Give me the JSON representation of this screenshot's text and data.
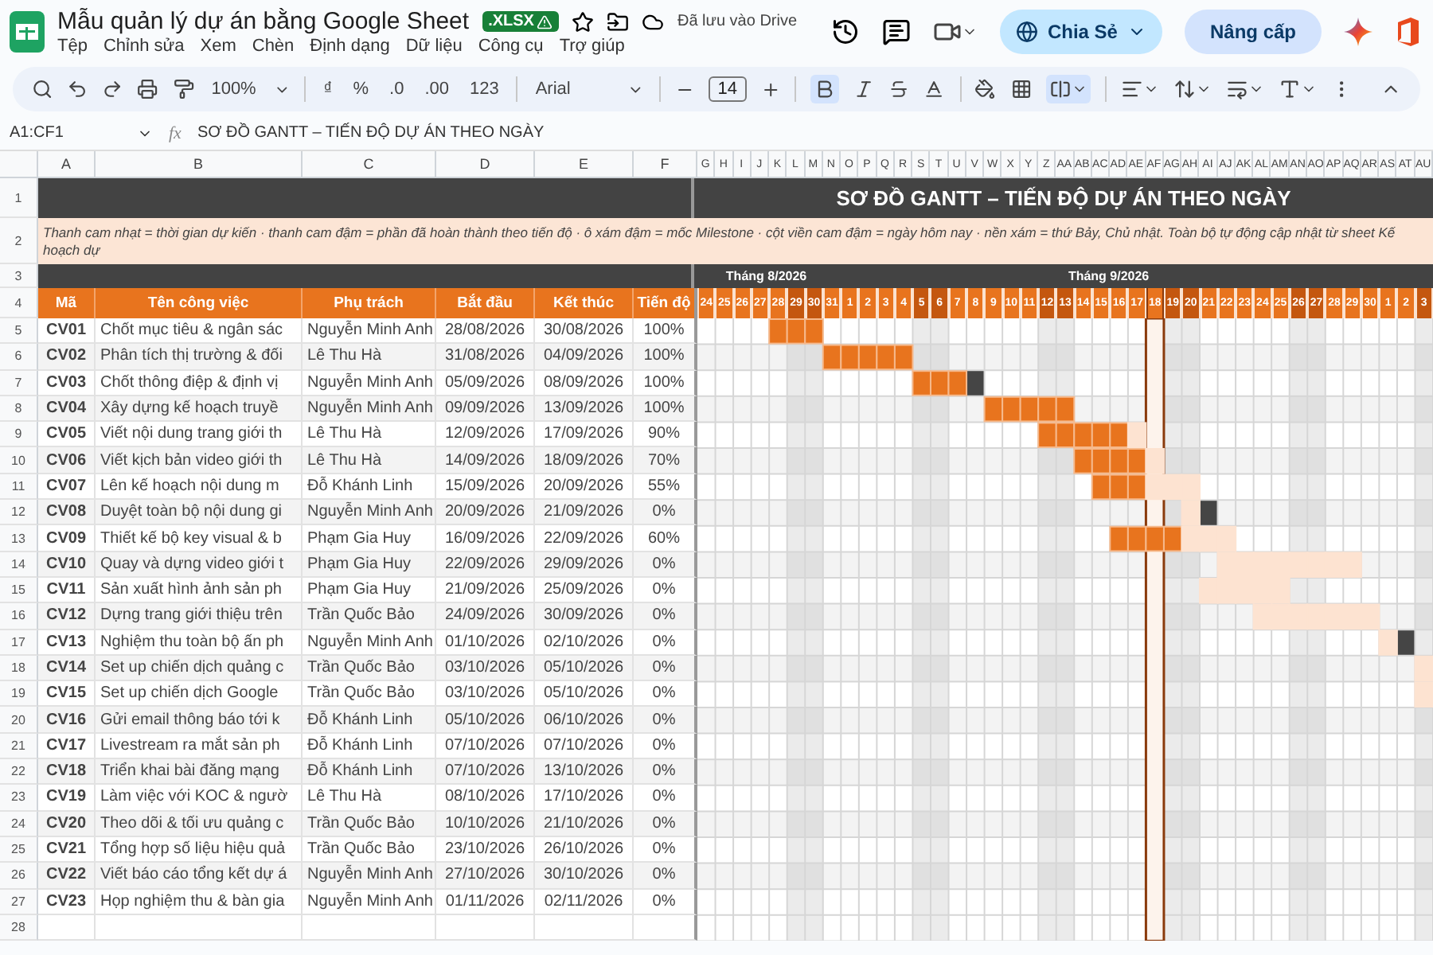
{
  "doc": {
    "title": "Mẫu quản lý dự án bằng Google Sheet",
    "badge": ".XLSX",
    "saved": "Đã lưu vào Drive"
  },
  "menu": [
    "Tệp",
    "Chỉnh sửa",
    "Xem",
    "Chèn",
    "Định dạng",
    "Dữ liệu",
    "Công cụ",
    "Trợ giúp"
  ],
  "actions": {
    "share": "Chia Sẻ",
    "upgrade": "Nâng cấp"
  },
  "toolbar": {
    "zoom": "100%",
    "currency": "₫",
    "percent": "%",
    "dec_less": ".0",
    "dec_more": ".00",
    "number_format": "123",
    "font": "Arial",
    "font_size": "14",
    "bold_selected": true,
    "merge_selected": true
  },
  "formula_bar": {
    "range": "A1:CF1",
    "fx": "fx",
    "value": "SƠ ĐỒ GANTT – TIẾN ĐỘ DỰ ÁN THEO NGÀY"
  },
  "columns": [
    "A",
    "B",
    "C",
    "D",
    "E",
    "F"
  ],
  "gantt_columns": [
    "G",
    "H",
    "I",
    "J",
    "K",
    "L",
    "M",
    "N",
    "O",
    "P",
    "Q",
    "R",
    "S",
    "T",
    "U",
    "V",
    "W",
    "X",
    "Y",
    "Z",
    "AA",
    "AB",
    "AC",
    "AD",
    "AE",
    "AF",
    "AG",
    "AH",
    "AI",
    "AJ",
    "AK",
    "AL",
    "AM",
    "AN",
    "AO",
    "AP",
    "AQ",
    "AR",
    "AS",
    "AT",
    "AU"
  ],
  "header_rows": [
    "1",
    "2",
    "3",
    "4"
  ],
  "title": "SƠ ĐỒ GANTT – TIẾN ĐỘ DỰ ÁN THEO NGÀY",
  "note": "Thanh cam nhạt = thời gian dự kiến · thanh cam đậm = phần đã hoàn thành theo tiến độ · ô xám đậm = mốc Milestone · cột viền cam đậm = ngày hôm nay · nền xám = thứ Bảy, Chủ nhật. Toàn bộ tự động cập nhật từ sheet Kế hoạch dự",
  "table_headers": [
    "Mã",
    "Tên công việc",
    "Phụ trách",
    "Bắt đầu",
    "Kết thúc",
    "Tiến độ"
  ],
  "days": [
    {
      "label": "24",
      "weekend": false,
      "today": false
    },
    {
      "label": "25",
      "weekend": false,
      "today": false
    },
    {
      "label": "26",
      "weekend": false,
      "today": false
    },
    {
      "label": "27",
      "weekend": false,
      "today": false
    },
    {
      "label": "28",
      "weekend": false,
      "today": false
    },
    {
      "label": "29",
      "weekend": true,
      "today": false
    },
    {
      "label": "30",
      "weekend": true,
      "today": false
    },
    {
      "label": "31",
      "weekend": false,
      "today": false
    },
    {
      "label": "1",
      "weekend": false,
      "today": false
    },
    {
      "label": "2",
      "weekend": false,
      "today": false
    },
    {
      "label": "3",
      "weekend": false,
      "today": false
    },
    {
      "label": "4",
      "weekend": false,
      "today": false
    },
    {
      "label": "5",
      "weekend": true,
      "today": false
    },
    {
      "label": "6",
      "weekend": true,
      "today": false
    },
    {
      "label": "7",
      "weekend": false,
      "today": false
    },
    {
      "label": "8",
      "weekend": false,
      "today": false
    },
    {
      "label": "9",
      "weekend": false,
      "today": false
    },
    {
      "label": "10",
      "weekend": false,
      "today": false
    },
    {
      "label": "11",
      "weekend": false,
      "today": false
    },
    {
      "label": "12",
      "weekend": true,
      "today": false
    },
    {
      "label": "13",
      "weekend": true,
      "today": false
    },
    {
      "label": "14",
      "weekend": false,
      "today": false
    },
    {
      "label": "15",
      "weekend": false,
      "today": false
    },
    {
      "label": "16",
      "weekend": false,
      "today": false
    },
    {
      "label": "17",
      "weekend": false,
      "today": false
    },
    {
      "label": "18",
      "weekend": false,
      "today": true
    },
    {
      "label": "19",
      "weekend": true,
      "today": false
    },
    {
      "label": "20",
      "weekend": true,
      "today": false
    },
    {
      "label": "21",
      "weekend": false,
      "today": false
    },
    {
      "label": "22",
      "weekend": false,
      "today": false
    },
    {
      "label": "23",
      "weekend": false,
      "today": false
    },
    {
      "label": "24",
      "weekend": false,
      "today": false
    },
    {
      "label": "25",
      "weekend": false,
      "today": false
    },
    {
      "label": "26",
      "weekend": true,
      "today": false
    },
    {
      "label": "27",
      "weekend": true,
      "today": false
    },
    {
      "label": "28",
      "weekend": false,
      "today": false
    },
    {
      "label": "29",
      "weekend": false,
      "today": false
    },
    {
      "label": "30",
      "weekend": false,
      "today": false
    },
    {
      "label": "1",
      "weekend": false,
      "today": false
    },
    {
      "label": "2",
      "weekend": false,
      "today": false
    },
    {
      "label": "3",
      "weekend": true,
      "today": false
    }
  ],
  "months": [
    {
      "label": "Tháng 8/2026"
    },
    {
      "label": "Tháng 9/2026"
    }
  ],
  "tasks": [
    {
      "row_label": "5",
      "code": "CV01",
      "name": "Chốt mục tiêu & ngân sác",
      "owner": "Nguyễn Minh Anh",
      "start": "28/08/2026",
      "end": "30/08/2026",
      "progress": "100%",
      "milestone": false
    },
    {
      "row_label": "6",
      "code": "CV02",
      "name": "Phân tích thị trường & đối",
      "owner": "Lê Thu Hà",
      "start": "31/08/2026",
      "end": "04/09/2026",
      "progress": "100%",
      "milestone": false
    },
    {
      "row_label": "7",
      "code": "CV03",
      "name": "Chốt thông điệp & định vị",
      "owner": "Nguyễn Minh Anh",
      "start": "05/09/2026",
      "end": "08/09/2026",
      "progress": "100%",
      "milestone": true
    },
    {
      "row_label": "8",
      "code": "CV04",
      "name": "Xây dựng kế hoạch truyề",
      "owner": "Nguyễn Minh Anh",
      "start": "09/09/2026",
      "end": "13/09/2026",
      "progress": "100%",
      "milestone": false
    },
    {
      "row_label": "9",
      "code": "CV05",
      "name": "Viết nội dung trang giới th",
      "owner": "Lê Thu Hà",
      "start": "12/09/2026",
      "end": "17/09/2026",
      "progress": "90%",
      "milestone": false
    },
    {
      "row_label": "10",
      "code": "CV06",
      "name": "Viết kịch bản video giới th",
      "owner": "Lê Thu Hà",
      "start": "14/09/2026",
      "end": "18/09/2026",
      "progress": "70%",
      "milestone": false
    },
    {
      "row_label": "11",
      "code": "CV07",
      "name": "Lên kế hoạch nội dung m",
      "owner": "Đỗ Khánh Linh",
      "start": "15/09/2026",
      "end": "20/09/2026",
      "progress": "55%",
      "milestone": false
    },
    {
      "row_label": "12",
      "code": "CV08",
      "name": "Duyệt toàn bộ nội dung gi",
      "owner": "Nguyễn Minh Anh",
      "start": "20/09/2026",
      "end": "21/09/2026",
      "progress": "0%",
      "milestone": true
    },
    {
      "row_label": "13",
      "code": "CV09",
      "name": "Thiết kế bộ key visual & b",
      "owner": "Phạm Gia Huy",
      "start": "16/09/2026",
      "end": "22/09/2026",
      "progress": "60%",
      "milestone": false
    },
    {
      "row_label": "14",
      "code": "CV10",
      "name": "Quay và dựng video giới t",
      "owner": "Phạm Gia Huy",
      "start": "22/09/2026",
      "end": "29/09/2026",
      "progress": "0%",
      "milestone": false
    },
    {
      "row_label": "15",
      "code": "CV11",
      "name": "Sản xuất hình ảnh sản ph",
      "owner": "Phạm Gia Huy",
      "start": "21/09/2026",
      "end": "25/09/2026",
      "progress": "0%",
      "milestone": false
    },
    {
      "row_label": "16",
      "code": "CV12",
      "name": "Dựng trang giới thiệu trên",
      "owner": "Trần Quốc Bảo",
      "start": "24/09/2026",
      "end": "30/09/2026",
      "progress": "0%",
      "milestone": false
    },
    {
      "row_label": "17",
      "code": "CV13",
      "name": "Nghiệm thu toàn bộ ấn ph",
      "owner": "Nguyễn Minh Anh",
      "start": "01/10/2026",
      "end": "02/10/2026",
      "progress": "0%",
      "milestone": true
    },
    {
      "row_label": "18",
      "code": "CV14",
      "name": "Set up chiến dịch quảng c",
      "owner": "Trần Quốc Bảo",
      "start": "03/10/2026",
      "end": "05/10/2026",
      "progress": "0%",
      "milestone": false
    },
    {
      "row_label": "19",
      "code": "CV15",
      "name": "Set up chiến dịch Google",
      "owner": "Trần Quốc Bảo",
      "start": "03/10/2026",
      "end": "05/10/2026",
      "progress": "0%",
      "milestone": false
    },
    {
      "row_label": "20",
      "code": "CV16",
      "name": "Gửi email thông báo tới k",
      "owner": "Đỗ Khánh Linh",
      "start": "05/10/2026",
      "end": "06/10/2026",
      "progress": "0%",
      "milestone": false
    },
    {
      "row_label": "21",
      "code": "CV17",
      "name": "Livestream ra mắt sản ph",
      "owner": "Đỗ Khánh Linh",
      "start": "07/10/2026",
      "end": "07/10/2026",
      "progress": "0%",
      "milestone": false
    },
    {
      "row_label": "22",
      "code": "CV18",
      "name": "Triển khai bài đăng mạng",
      "owner": "Đỗ Khánh Linh",
      "start": "07/10/2026",
      "end": "13/10/2026",
      "progress": "0%",
      "milestone": false
    },
    {
      "row_label": "23",
      "code": "CV19",
      "name": "Làm việc với KOC & ngườ",
      "owner": "Lê Thu Hà",
      "start": "08/10/2026",
      "end": "17/10/2026",
      "progress": "0%",
      "milestone": false
    },
    {
      "row_label": "24",
      "code": "CV20",
      "name": "Theo dõi & tối ưu quảng c",
      "owner": "Trần Quốc Bảo",
      "start": "10/10/2026",
      "end": "21/10/2026",
      "progress": "0%",
      "milestone": false
    },
    {
      "row_label": "25",
      "code": "CV21",
      "name": "Tổng hợp số liệu hiệu quả",
      "owner": "Trần Quốc Bảo",
      "start": "23/10/2026",
      "end": "26/10/2026",
      "progress": "0%",
      "milestone": false
    },
    {
      "row_label": "26",
      "code": "CV22",
      "name": "Viết báo cáo tổng kết dự á",
      "owner": "Nguyễn Minh Anh",
      "start": "27/10/2026",
      "end": "30/10/2026",
      "progress": "0%",
      "milestone": false
    },
    {
      "row_label": "27",
      "code": "CV23",
      "name": "Họp nghiệm thu & bàn gia",
      "owner": "Nguyễn Minh Anh",
      "start": "01/11/2026",
      "end": "02/11/2026",
      "progress": "0%",
      "milestone": false
    }
  ],
  "empty_rows": [
    "28"
  ]
}
